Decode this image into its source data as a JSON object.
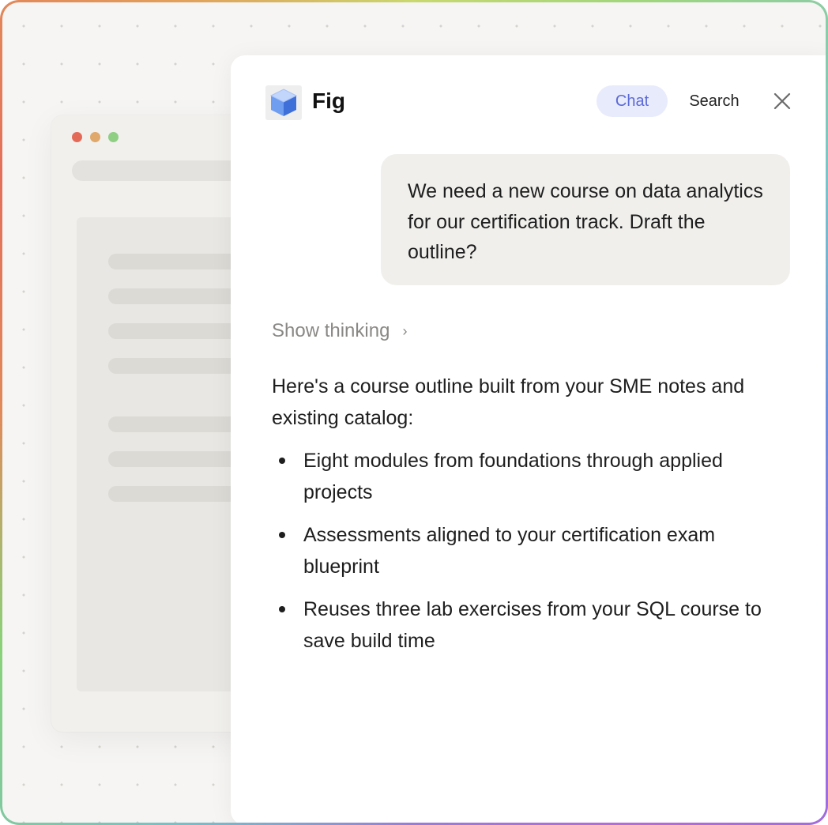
{
  "app": {
    "name": "Fig"
  },
  "tabs": {
    "chat": "Chat",
    "search": "Search"
  },
  "conversation": {
    "user_message": "We need a new course on data analytics for our certification track. Draft the outline?",
    "show_thinking_label": "Show thinking",
    "response": {
      "intro": "Here's a course outline built from your SME notes and existing catalog:",
      "bullets": [
        "Eight modules from foundations through applied projects",
        "Assessments aligned to your certification exam blueprint",
        "Reuses three lab exercises from your SQL course to save build time"
      ]
    }
  },
  "colors": {
    "active_tab_bg": "#e8ebfb",
    "active_tab_text": "#5c6ad8",
    "user_bubble_bg": "#f0efec"
  },
  "icons": {
    "logo": "cube-icon",
    "close": "close-icon",
    "chevron": "chevron-right-icon"
  }
}
